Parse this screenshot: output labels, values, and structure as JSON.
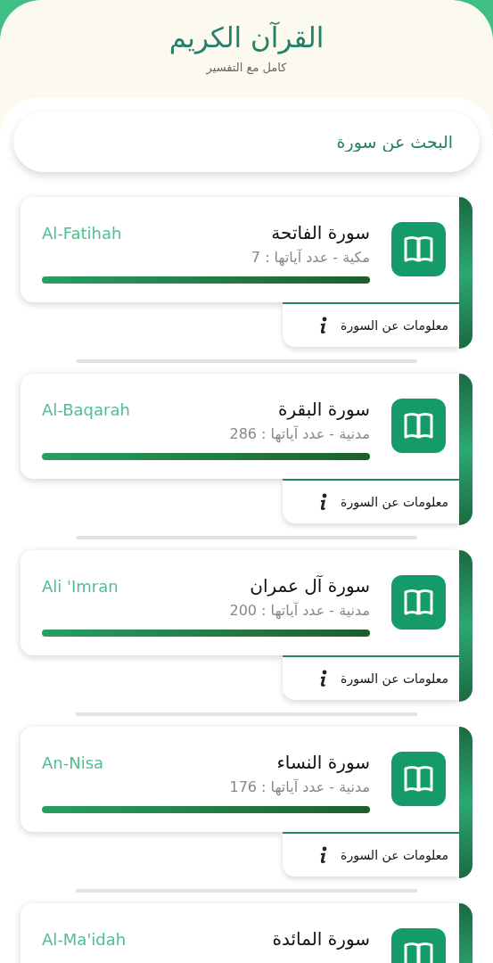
{
  "header": {
    "title": "القرآن الكريم",
    "subtitle": "كامل مع التفسير"
  },
  "search": {
    "placeholder": "البحث عن سورة"
  },
  "surahs": [
    {
      "name": "سورة الفاتحة",
      "details": "مكية - عدد آياتها : 7",
      "english": "Al-Fatihah",
      "info": "معلومات عن السورة"
    },
    {
      "name": "سورة البقرة",
      "details": "مدنية - عدد آياتها : 286",
      "english": "Al-Baqarah",
      "info": "معلومات عن السورة"
    },
    {
      "name": "سورة آل عمران",
      "details": "مدنية - عدد آياتها : 200",
      "english": "Ali 'Imran",
      "info": "معلومات عن السورة"
    },
    {
      "name": "سورة النساء",
      "details": "مدنية - عدد آياتها : 176",
      "english": "An-Nisa",
      "info": "معلومات عن السورة"
    },
    {
      "name": "سورة المائدة",
      "english": "Al-Ma'idah"
    }
  ]
}
